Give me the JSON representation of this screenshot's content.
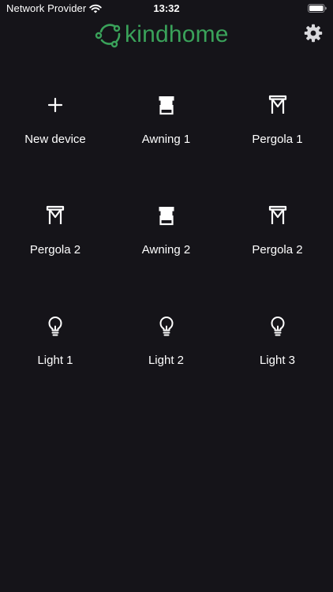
{
  "status_bar": {
    "carrier": "Network Provider",
    "time": "13:32"
  },
  "header": {
    "logo_text": "kindhome",
    "brand_color": "#3aa25a"
  },
  "devices": [
    {
      "label": "New device",
      "icon": "plus-icon"
    },
    {
      "label": "Awning 1",
      "icon": "awning-icon"
    },
    {
      "label": "Pergola 1",
      "icon": "pergola-icon"
    },
    {
      "label": "Pergola 2",
      "icon": "pergola-icon"
    },
    {
      "label": "Awning 2",
      "icon": "awning-icon"
    },
    {
      "label": "Pergola 2",
      "icon": "pergola-icon"
    },
    {
      "label": "Light 1",
      "icon": "lightbulb-icon"
    },
    {
      "label": "Light 2",
      "icon": "lightbulb-icon"
    },
    {
      "label": "Light 3",
      "icon": "lightbulb-icon"
    }
  ]
}
